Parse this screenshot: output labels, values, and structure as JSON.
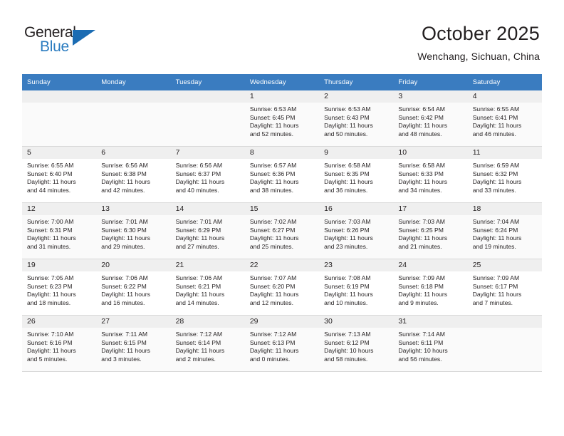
{
  "logo": {
    "name_top": "General",
    "name_bottom": "Blue",
    "triangle_color": "#1b6cb3",
    "text_color": "#231f20",
    "blue_color": "#2b7cc0"
  },
  "header": {
    "title": "October 2025",
    "subtitle": "Wenchang, Sichuan, China"
  },
  "colors": {
    "header_row_bg": "#3a7cc0",
    "header_row_text": "#ffffff",
    "daynum_bg": "#efefef",
    "row_shaded_bg": "#fafafa",
    "grid_line": "#d9d9d9"
  },
  "weekday_headers": [
    "Sunday",
    "Monday",
    "Tuesday",
    "Wednesday",
    "Thursday",
    "Friday",
    "Saturday"
  ],
  "weeks": [
    [
      {
        "day": "",
        "lines": []
      },
      {
        "day": "",
        "lines": []
      },
      {
        "day": "",
        "lines": []
      },
      {
        "day": "1",
        "lines": [
          "Sunrise: 6:53 AM",
          "Sunset: 6:45 PM",
          "Daylight: 11 hours",
          "and 52 minutes."
        ]
      },
      {
        "day": "2",
        "lines": [
          "Sunrise: 6:53 AM",
          "Sunset: 6:43 PM",
          "Daylight: 11 hours",
          "and 50 minutes."
        ]
      },
      {
        "day": "3",
        "lines": [
          "Sunrise: 6:54 AM",
          "Sunset: 6:42 PM",
          "Daylight: 11 hours",
          "and 48 minutes."
        ]
      },
      {
        "day": "4",
        "lines": [
          "Sunrise: 6:55 AM",
          "Sunset: 6:41 PM",
          "Daylight: 11 hours",
          "and 46 minutes."
        ]
      }
    ],
    [
      {
        "day": "5",
        "lines": [
          "Sunrise: 6:55 AM",
          "Sunset: 6:40 PM",
          "Daylight: 11 hours",
          "and 44 minutes."
        ]
      },
      {
        "day": "6",
        "lines": [
          "Sunrise: 6:56 AM",
          "Sunset: 6:38 PM",
          "Daylight: 11 hours",
          "and 42 minutes."
        ]
      },
      {
        "day": "7",
        "lines": [
          "Sunrise: 6:56 AM",
          "Sunset: 6:37 PM",
          "Daylight: 11 hours",
          "and 40 minutes."
        ]
      },
      {
        "day": "8",
        "lines": [
          "Sunrise: 6:57 AM",
          "Sunset: 6:36 PM",
          "Daylight: 11 hours",
          "and 38 minutes."
        ]
      },
      {
        "day": "9",
        "lines": [
          "Sunrise: 6:58 AM",
          "Sunset: 6:35 PM",
          "Daylight: 11 hours",
          "and 36 minutes."
        ]
      },
      {
        "day": "10",
        "lines": [
          "Sunrise: 6:58 AM",
          "Sunset: 6:33 PM",
          "Daylight: 11 hours",
          "and 34 minutes."
        ]
      },
      {
        "day": "11",
        "lines": [
          "Sunrise: 6:59 AM",
          "Sunset: 6:32 PM",
          "Daylight: 11 hours",
          "and 33 minutes."
        ]
      }
    ],
    [
      {
        "day": "12",
        "lines": [
          "Sunrise: 7:00 AM",
          "Sunset: 6:31 PM",
          "Daylight: 11 hours",
          "and 31 minutes."
        ]
      },
      {
        "day": "13",
        "lines": [
          "Sunrise: 7:01 AM",
          "Sunset: 6:30 PM",
          "Daylight: 11 hours",
          "and 29 minutes."
        ]
      },
      {
        "day": "14",
        "lines": [
          "Sunrise: 7:01 AM",
          "Sunset: 6:29 PM",
          "Daylight: 11 hours",
          "and 27 minutes."
        ]
      },
      {
        "day": "15",
        "lines": [
          "Sunrise: 7:02 AM",
          "Sunset: 6:27 PM",
          "Daylight: 11 hours",
          "and 25 minutes."
        ]
      },
      {
        "day": "16",
        "lines": [
          "Sunrise: 7:03 AM",
          "Sunset: 6:26 PM",
          "Daylight: 11 hours",
          "and 23 minutes."
        ]
      },
      {
        "day": "17",
        "lines": [
          "Sunrise: 7:03 AM",
          "Sunset: 6:25 PM",
          "Daylight: 11 hours",
          "and 21 minutes."
        ]
      },
      {
        "day": "18",
        "lines": [
          "Sunrise: 7:04 AM",
          "Sunset: 6:24 PM",
          "Daylight: 11 hours",
          "and 19 minutes."
        ]
      }
    ],
    [
      {
        "day": "19",
        "lines": [
          "Sunrise: 7:05 AM",
          "Sunset: 6:23 PM",
          "Daylight: 11 hours",
          "and 18 minutes."
        ]
      },
      {
        "day": "20",
        "lines": [
          "Sunrise: 7:06 AM",
          "Sunset: 6:22 PM",
          "Daylight: 11 hours",
          "and 16 minutes."
        ]
      },
      {
        "day": "21",
        "lines": [
          "Sunrise: 7:06 AM",
          "Sunset: 6:21 PM",
          "Daylight: 11 hours",
          "and 14 minutes."
        ]
      },
      {
        "day": "22",
        "lines": [
          "Sunrise: 7:07 AM",
          "Sunset: 6:20 PM",
          "Daylight: 11 hours",
          "and 12 minutes."
        ]
      },
      {
        "day": "23",
        "lines": [
          "Sunrise: 7:08 AM",
          "Sunset: 6:19 PM",
          "Daylight: 11 hours",
          "and 10 minutes."
        ]
      },
      {
        "day": "24",
        "lines": [
          "Sunrise: 7:09 AM",
          "Sunset: 6:18 PM",
          "Daylight: 11 hours",
          "and 9 minutes."
        ]
      },
      {
        "day": "25",
        "lines": [
          "Sunrise: 7:09 AM",
          "Sunset: 6:17 PM",
          "Daylight: 11 hours",
          "and 7 minutes."
        ]
      }
    ],
    [
      {
        "day": "26",
        "lines": [
          "Sunrise: 7:10 AM",
          "Sunset: 6:16 PM",
          "Daylight: 11 hours",
          "and 5 minutes."
        ]
      },
      {
        "day": "27",
        "lines": [
          "Sunrise: 7:11 AM",
          "Sunset: 6:15 PM",
          "Daylight: 11 hours",
          "and 3 minutes."
        ]
      },
      {
        "day": "28",
        "lines": [
          "Sunrise: 7:12 AM",
          "Sunset: 6:14 PM",
          "Daylight: 11 hours",
          "and 2 minutes."
        ]
      },
      {
        "day": "29",
        "lines": [
          "Sunrise: 7:12 AM",
          "Sunset: 6:13 PM",
          "Daylight: 11 hours",
          "and 0 minutes."
        ]
      },
      {
        "day": "30",
        "lines": [
          "Sunrise: 7:13 AM",
          "Sunset: 6:12 PM",
          "Daylight: 10 hours",
          "and 58 minutes."
        ]
      },
      {
        "day": "31",
        "lines": [
          "Sunrise: 7:14 AM",
          "Sunset: 6:11 PM",
          "Daylight: 10 hours",
          "and 56 minutes."
        ]
      },
      {
        "day": "",
        "lines": []
      }
    ]
  ]
}
